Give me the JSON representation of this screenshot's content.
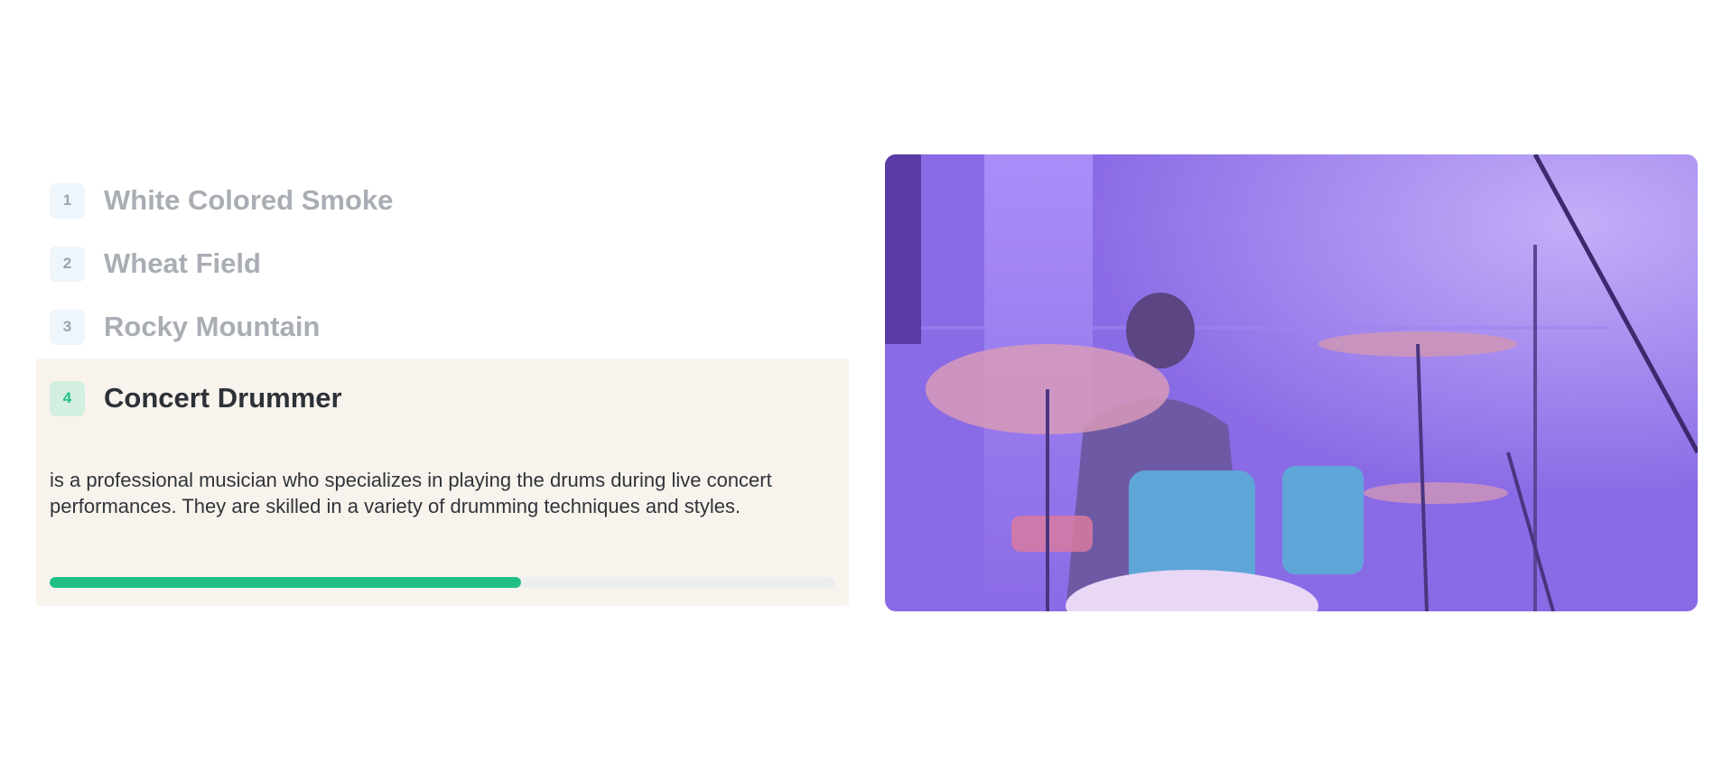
{
  "items": [
    {
      "number": "1",
      "title": "White Colored Smoke"
    },
    {
      "number": "2",
      "title": "Wheat Field"
    },
    {
      "number": "3",
      "title": "Rocky Mountain"
    },
    {
      "number": "4",
      "title": "Concert Drummer"
    }
  ],
  "active": {
    "index": 3,
    "description": "is a professional musician who specializes in playing the drums during live concert performances. They are skilled in a variety of drumming techniques and styles.",
    "progress": 0.6
  },
  "colors": {
    "accent": "#21bf85",
    "active_bg": "#f8f3ec",
    "inactive_text": "#a9adb4",
    "active_text": "#2d3138",
    "photo_tint": "#8f6ee8"
  }
}
